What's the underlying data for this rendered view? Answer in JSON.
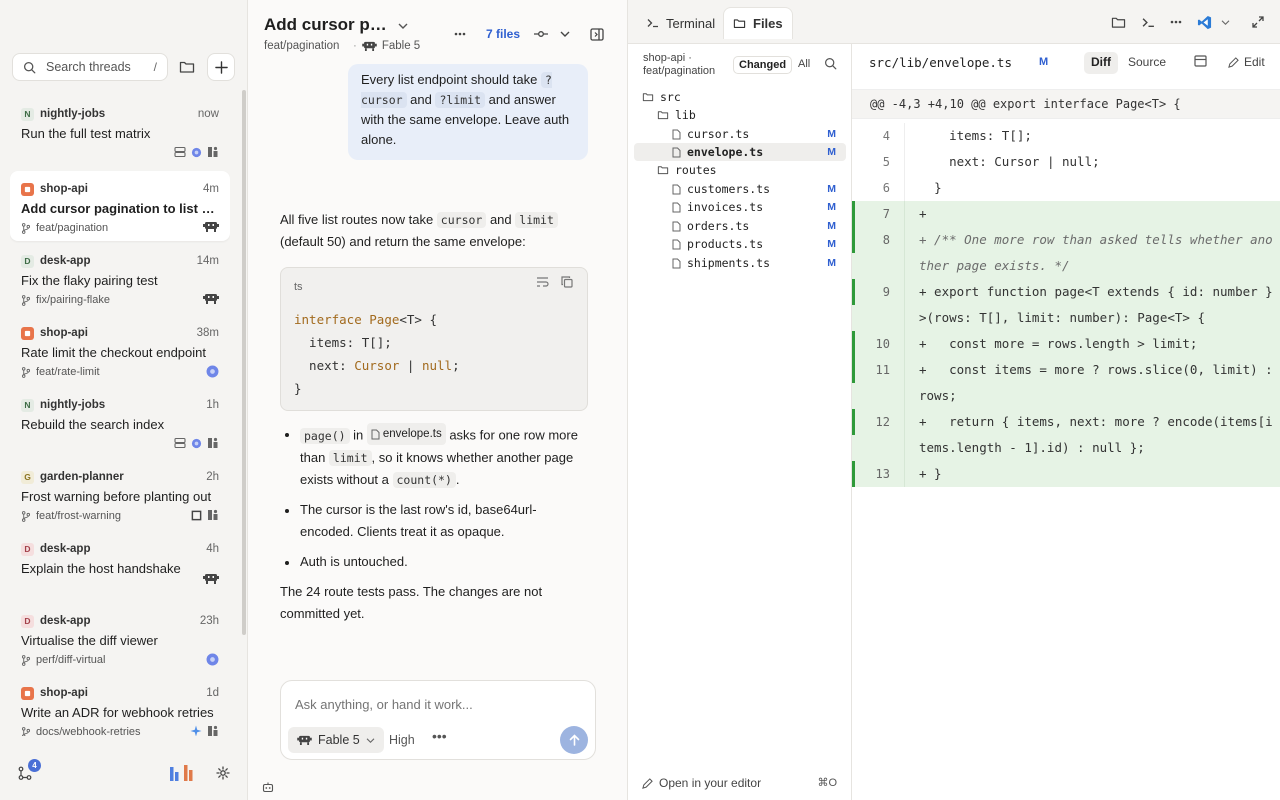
{
  "sidebar": {
    "search_placeholder": "Search threads",
    "search_shortcut": "/",
    "threads": [
      {
        "project": "nightly-jobs",
        "initial": "N",
        "time": "now",
        "title": "Run the full test matrix",
        "branch": ""
      },
      {
        "project": "shop-api",
        "initial": "S",
        "time": "4m",
        "title": "Add cursor pagination to list endpoints",
        "branch": "feat/pagination"
      },
      {
        "project": "desk-app",
        "initial": "D",
        "time": "14m",
        "title": "Fix the flaky pairing test",
        "branch": "fix/pairing-flake"
      },
      {
        "project": "shop-api",
        "initial": "S",
        "time": "38m",
        "title": "Rate limit the checkout endpoint",
        "branch": "feat/rate-limit"
      },
      {
        "project": "nightly-jobs",
        "initial": "N",
        "time": "1h",
        "title": "Rebuild the search index",
        "branch": ""
      },
      {
        "project": "garden-planner",
        "initial": "G",
        "time": "2h",
        "title": "Frost warning before planting out",
        "branch": "feat/frost-warning"
      },
      {
        "project": "desk-app",
        "initial": "D",
        "time": "4h",
        "title": "Explain the host handshake",
        "branch": ""
      },
      {
        "project": "desk-app",
        "initial": "D",
        "time": "23h",
        "title": "Virtualise the diff viewer",
        "branch": "perf/diff-virtual"
      },
      {
        "project": "shop-api",
        "initial": "S",
        "time": "1d",
        "title": "Write an ADR for webhook retries",
        "branch": "docs/webhook-retries"
      }
    ],
    "branch_count": "4"
  },
  "chat": {
    "title": "Add cursor pagination to list endpoints",
    "branch": "feat/pagination",
    "model_short": "Fable 5",
    "files_chip": "7 files",
    "user_message": {
      "p1": "Every list endpoint should take ",
      "c1": "?cursor",
      "p2": " and ",
      "c2": "?limit",
      "p3": " and answer with the same envelope. Leave auth alone."
    },
    "response": {
      "intro_a": "All five list routes now take ",
      "intro_c1": "cursor",
      "intro_b": " and ",
      "intro_c2": "limit",
      "intro_c": " (default 50) and return the same envelope:",
      "code_lang": "ts",
      "bullet1_c1": "page()",
      "bullet1_a": " in ",
      "bullet1_file": "envelope.ts",
      "bullet1_b": " asks for one row more than ",
      "bullet1_c2": "limit",
      "bullet1_c": ", so it knows whether another page exists without a ",
      "bullet1_c3": "count(*)",
      "bullet1_d": ".",
      "bullet2": "The cursor is the last row's id, base64url-encoded. Clients treat it as opaque.",
      "bullet3": "Auth is untouched.",
      "closing": "The 24 route tests pass. The changes are not committed yet."
    },
    "composer": {
      "placeholder": "Ask anything, or hand it work...",
      "model": "Fable 5",
      "effort": "High",
      "more": "•••"
    }
  },
  "right": {
    "tabs": [
      "Terminal",
      "Files"
    ],
    "active_tab": "Files",
    "tree": {
      "repo": "shop-api · feat/pagination",
      "filter_changed": "Changed",
      "filter_all": "All",
      "items": [
        {
          "name": "src",
          "type": "folder",
          "depth": 0,
          "status": ""
        },
        {
          "name": "lib",
          "type": "folder",
          "depth": 1,
          "status": ""
        },
        {
          "name": "cursor.ts",
          "type": "file",
          "depth": 2,
          "status": "M"
        },
        {
          "name": "envelope.ts",
          "type": "file",
          "depth": 2,
          "status": "M",
          "selected": true
        },
        {
          "name": "routes",
          "type": "folder",
          "depth": 1,
          "status": ""
        },
        {
          "name": "customers.ts",
          "type": "file",
          "depth": 2,
          "status": "M"
        },
        {
          "name": "invoices.ts",
          "type": "file",
          "depth": 2,
          "status": "M"
        },
        {
          "name": "orders.ts",
          "type": "file",
          "depth": 2,
          "status": "M"
        },
        {
          "name": "products.ts",
          "type": "file",
          "depth": 2,
          "status": "M"
        },
        {
          "name": "shipments.ts",
          "type": "file",
          "depth": 2,
          "status": "M"
        }
      ],
      "open_in_editor": "Open in your editor",
      "shortcut": "⌘O"
    },
    "diff": {
      "path": "src/lib/envelope.ts",
      "status": "M",
      "view_diff": "Diff",
      "view_source": "Source",
      "edit": "Edit",
      "hunk": "@@ -4,3 +4,10 @@ export interface Page<T> {",
      "lines": [
        {
          "n": "4",
          "kind": "ctx",
          "text": "    items: T[];"
        },
        {
          "n": "5",
          "kind": "ctx",
          "text": "    next: Cursor | null;"
        },
        {
          "n": "6",
          "kind": "ctx",
          "text": "  }"
        },
        {
          "n": "7",
          "kind": "add",
          "text": "+"
        },
        {
          "n": "8",
          "kind": "add",
          "text": "+ /** One more row than asked tells whether another page exists. */"
        },
        {
          "n": "9",
          "kind": "add",
          "text": "+ export function page<T extends { id: number }>(rows: T[], limit: number): Page<T> {"
        },
        {
          "n": "10",
          "kind": "add",
          "text": "+   const more = rows.length > limit;"
        },
        {
          "n": "11",
          "kind": "add",
          "text": "+   const items = more ? rows.slice(0, limit) : rows;"
        },
        {
          "n": "12",
          "kind": "add",
          "text": "+   return { items, next: more ? encode(items[items.length - 1].id) : null };"
        },
        {
          "n": "13",
          "kind": "add",
          "text": "+ }"
        }
      ]
    }
  },
  "colors": {
    "accent": "#2f5fd0",
    "add_bg": "#e6f3e5",
    "add_bar": "#2f9a3a",
    "shop_api": "#e8744a",
    "nightly_jobs": "#e4ebe4",
    "desk_app": "#f5dede",
    "garden_planner": "#f1ecd8"
  }
}
